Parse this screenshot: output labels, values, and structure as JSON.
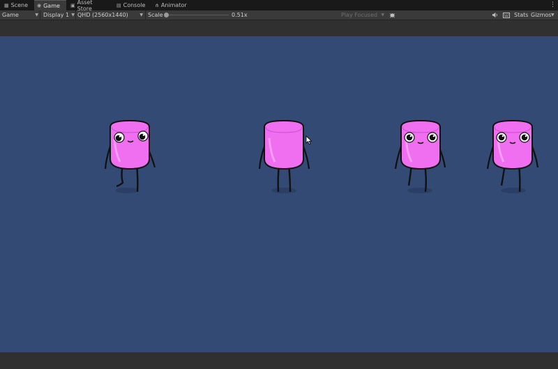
{
  "tabs": [
    {
      "label": "Scene",
      "icon": "scene-grid-icon"
    },
    {
      "label": "Game",
      "icon": "gamepad-icon",
      "active": true
    },
    {
      "label": "Asset Store",
      "icon": "shopping-bag-icon"
    },
    {
      "label": "Console",
      "icon": "console-icon"
    },
    {
      "label": "Animator",
      "icon": "animator-nodes-icon"
    }
  ],
  "toolbar": {
    "view_select": "Game",
    "display_select": "Display 1",
    "resolution_select": "QHD (2560x1440)",
    "scale_label": "Scale",
    "scale_value": "0.51x",
    "scale_fraction": 0.0,
    "play_mode_select": "Play Focused",
    "stats_label": "Stats",
    "gizmos_label": "Gizmos"
  },
  "colors": {
    "game_background": "#324a74",
    "character_body": "#f06ef0",
    "editor_panel": "#3a3a3a",
    "tab_strip": "#191919"
  },
  "characters": [
    {
      "facing": "front-left",
      "face_visible": true
    },
    {
      "facing": "back",
      "face_visible": false
    },
    {
      "facing": "front",
      "face_visible": true
    },
    {
      "facing": "front",
      "face_visible": true
    }
  ]
}
